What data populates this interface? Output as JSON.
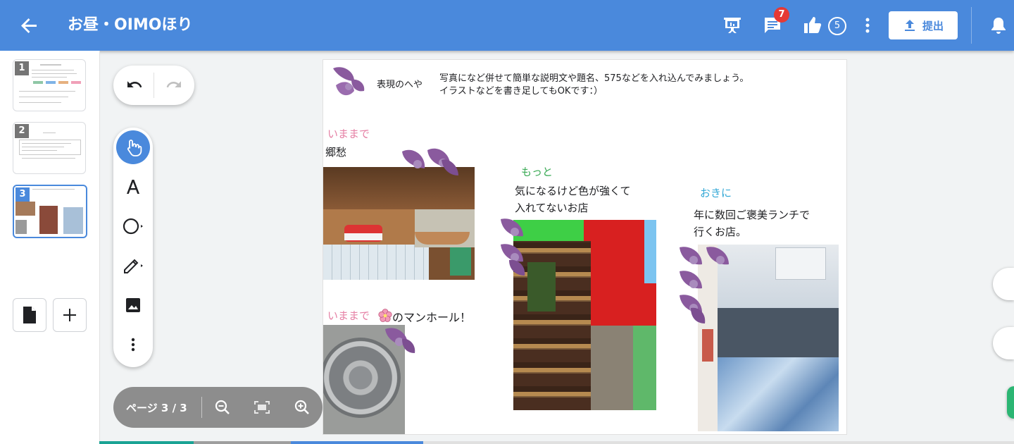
{
  "header": {
    "title": "お昼・OIMOほり",
    "comment_badge": "7",
    "like_count": "5",
    "submit_label": "提出"
  },
  "thumbnails": [
    {
      "number": "1"
    },
    {
      "number": "2"
    },
    {
      "number": "3"
    }
  ],
  "zoom": {
    "page_label": "ページ 3 / 3"
  },
  "page": {
    "heading": "表現のへや",
    "instruction_line1": "写真になど併せて簡単な説明文や題名、575などを入れ込んでみましょう。",
    "instruction_line2": "イラストなどを書き足してもOKです：）",
    "section1_label": "いままで",
    "section1_caption": "郷愁",
    "section2_label": "いままで",
    "section2_caption": "のマンホール！",
    "section3_label": "もっと",
    "section3_line1": "気になるけど色が強くて",
    "section3_line2": "入れてないお店",
    "section4_label": "おきに",
    "section4_line1": "年に数回ご褒美ランチで",
    "section4_line2": "行くお店。"
  },
  "colors": {
    "header_blue": "#4a89dc",
    "label_pink": "#e57fa4",
    "label_green": "#3aaa55",
    "label_cyan": "#33a8d6",
    "petal_purple": "#8a5a9e",
    "badge_red": "#e53935"
  },
  "icons": {
    "back": "arrow-left-icon",
    "present": "presentation-icon",
    "comment": "comment-icon",
    "like": "thumbs-up-icon",
    "more": "more-vert-icon",
    "upload": "upload-icon",
    "bell": "bell-icon"
  }
}
